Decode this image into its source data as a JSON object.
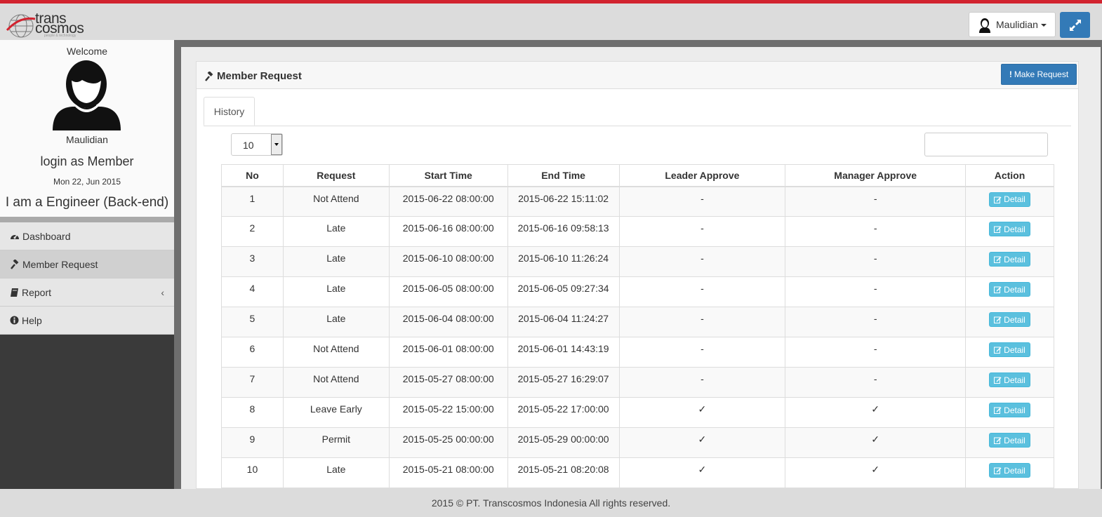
{
  "topbar": {
    "logo_line1": "trans",
    "logo_line2": "cosmos",
    "logo_tagline": "people & technology",
    "user_name": "Maulidian"
  },
  "sidebar": {
    "welcome": "Welcome",
    "username": "Maulidian",
    "login_as": "login as Member",
    "date": "Mon 22, Jun 2015",
    "role": "I am a Engineer (Back-end)",
    "menu": [
      {
        "label": "Dashboard",
        "icon": "dashboard-icon"
      },
      {
        "label": "Member Request",
        "icon": "gavel-icon"
      },
      {
        "label": "Report",
        "icon": "book-icon"
      },
      {
        "label": "Help",
        "icon": "info-circle-icon"
      }
    ]
  },
  "panel": {
    "title": "Member Request",
    "make_request": "Make Request",
    "tab_history": "History",
    "page_length": "10",
    "search_value": ""
  },
  "table": {
    "headers": [
      "No",
      "Request",
      "Start Time",
      "End Time",
      "Leader Approve",
      "Manager Approve",
      "Action"
    ],
    "detail_label": "Detail",
    "rows": [
      {
        "no": "1",
        "request": "Not Attend",
        "start": "2015-06-22 08:00:00",
        "end": "2015-06-22 15:11:02",
        "leader": "-",
        "manager": "-"
      },
      {
        "no": "2",
        "request": "Late",
        "start": "2015-06-16 08:00:00",
        "end": "2015-06-16 09:58:13",
        "leader": "-",
        "manager": "-"
      },
      {
        "no": "3",
        "request": "Late",
        "start": "2015-06-10 08:00:00",
        "end": "2015-06-10 11:26:24",
        "leader": "-",
        "manager": "-"
      },
      {
        "no": "4",
        "request": "Late",
        "start": "2015-06-05 08:00:00",
        "end": "2015-06-05 09:27:34",
        "leader": "-",
        "manager": "-"
      },
      {
        "no": "5",
        "request": "Late",
        "start": "2015-06-04 08:00:00",
        "end": "2015-06-04 11:24:27",
        "leader": "-",
        "manager": "-"
      },
      {
        "no": "6",
        "request": "Not Attend",
        "start": "2015-06-01 08:00:00",
        "end": "2015-06-01 14:43:19",
        "leader": "-",
        "manager": "-"
      },
      {
        "no": "7",
        "request": "Not Attend",
        "start": "2015-05-27 08:00:00",
        "end": "2015-05-27 16:29:07",
        "leader": "-",
        "manager": "-"
      },
      {
        "no": "8",
        "request": "Leave Early",
        "start": "2015-05-22 15:00:00",
        "end": "2015-05-22 17:00:00",
        "leader": "✓",
        "manager": "✓"
      },
      {
        "no": "9",
        "request": "Permit",
        "start": "2015-05-25 00:00:00",
        "end": "2015-05-29 00:00:00",
        "leader": "✓",
        "manager": "✓"
      },
      {
        "no": "10",
        "request": "Late",
        "start": "2015-05-21 08:00:00",
        "end": "2015-05-21 08:20:08",
        "leader": "✓",
        "manager": "✓"
      }
    ]
  },
  "footer": {
    "text": "2015 © PT. Transcosmos Indonesia All rights reserved."
  },
  "colors": {
    "accent_red": "#d2232f",
    "primary_blue": "#337ab7",
    "info_blue": "#5bc0de"
  }
}
